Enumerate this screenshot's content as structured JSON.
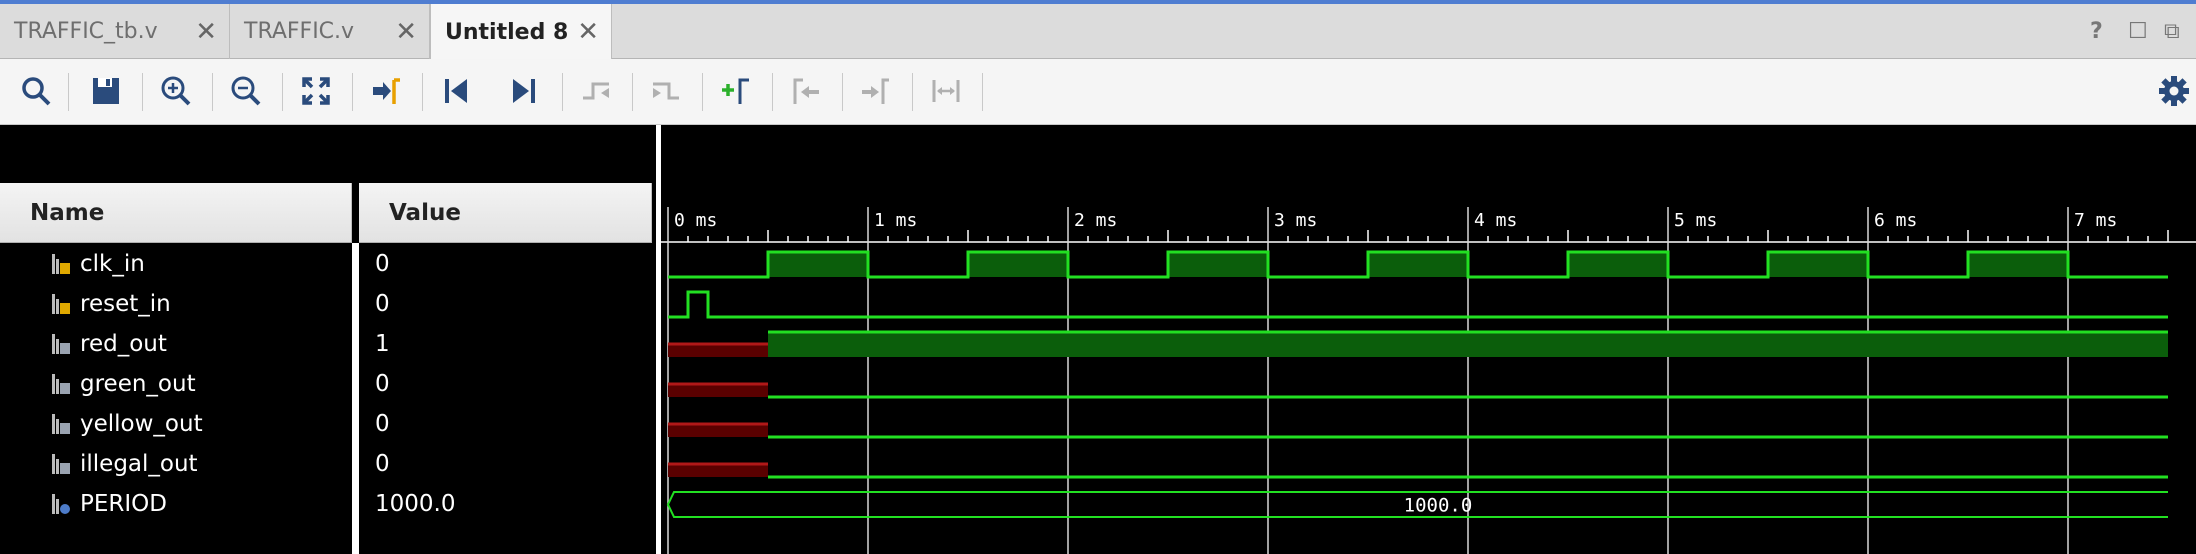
{
  "tabs": [
    {
      "label": "TRAFFIC_tb.v",
      "active": false
    },
    {
      "label": "TRAFFIC.v",
      "active": false
    },
    {
      "label": "Untitled 8",
      "active": true
    }
  ],
  "window_controls": {
    "help": "?",
    "maximize": "☐",
    "float": "⧉"
  },
  "toolbar": [
    {
      "icon": "search-icon",
      "enabled": true
    },
    {
      "icon": "save-icon",
      "enabled": true
    },
    {
      "icon": "zoom-in-icon",
      "enabled": true
    },
    {
      "icon": "zoom-out-icon",
      "enabled": true
    },
    {
      "icon": "zoom-fit-icon",
      "enabled": true
    },
    {
      "icon": "go-to-cursor-icon",
      "enabled": true
    },
    {
      "icon": "go-to-time-zero-icon",
      "enabled": true
    },
    {
      "icon": "go-to-last-time-icon",
      "enabled": true
    },
    {
      "icon": "previous-transition-icon",
      "enabled": false
    },
    {
      "icon": "next-transition-icon",
      "enabled": false
    },
    {
      "icon": "add-marker-icon",
      "enabled": true
    },
    {
      "icon": "previous-marker-icon",
      "enabled": false
    },
    {
      "icon": "next-marker-icon",
      "enabled": false
    },
    {
      "icon": "swap-cursors-icon",
      "enabled": false
    },
    {
      "icon": "settings-icon",
      "enabled": true
    }
  ],
  "columns": {
    "name": "Name",
    "value": "Value"
  },
  "signals": [
    {
      "name": "clk_in",
      "value": "0",
      "icon": "input-signal-icon"
    },
    {
      "name": "reset_in",
      "value": "0",
      "icon": "input-signal-icon"
    },
    {
      "name": "red_out",
      "value": "1",
      "icon": "output-signal-icon"
    },
    {
      "name": "green_out",
      "value": "0",
      "icon": "output-signal-icon"
    },
    {
      "name": "yellow_out",
      "value": "0",
      "icon": "output-signal-icon"
    },
    {
      "name": "illegal_out",
      "value": "0",
      "icon": "output-signal-icon"
    },
    {
      "name": "PERIOD",
      "value": "1000.0",
      "icon": "parameter-icon"
    }
  ],
  "timeline": {
    "unit": "ms",
    "start": 0,
    "end": 7.5,
    "tick_labels": [
      "0 ms",
      "1 ms",
      "2 ms",
      "3 ms",
      "4 ms",
      "5 ms",
      "6 ms",
      "7 ms"
    ],
    "minor_ticks_per_major": 10
  },
  "waveforms": {
    "clk_in": {
      "type": "clock",
      "period": 1.0,
      "first_rise": 0.5,
      "initial": 0
    },
    "reset_in": {
      "type": "bit",
      "segments": [
        [
          0,
          0.1,
          0
        ],
        [
          0.1,
          0.2,
          1
        ],
        [
          0.2,
          7.5,
          0
        ]
      ]
    },
    "red_out": {
      "type": "bit",
      "undefined_until": 0.5,
      "segments": [
        [
          0.5,
          7.5,
          1
        ]
      ]
    },
    "green_out": {
      "type": "bit",
      "undefined_until": 0.5,
      "segments": [
        [
          0.5,
          7.5,
          0
        ]
      ]
    },
    "yellow_out": {
      "type": "bit",
      "undefined_until": 0.5,
      "segments": [
        [
          0.5,
          7.5,
          0
        ]
      ]
    },
    "illegal_out": {
      "type": "bit",
      "undefined_until": 0.5,
      "segments": [
        [
          0.5,
          7.5,
          0
        ]
      ]
    },
    "PERIOD": {
      "type": "bus",
      "label": "1000.0",
      "label_time": 3.85
    }
  },
  "colors": {
    "wave": "#22e022",
    "high_fill": "#0b5e0b",
    "undefined": "#b01818",
    "undefined_fill": "#5a0000",
    "grid": "#d8d8d8"
  }
}
